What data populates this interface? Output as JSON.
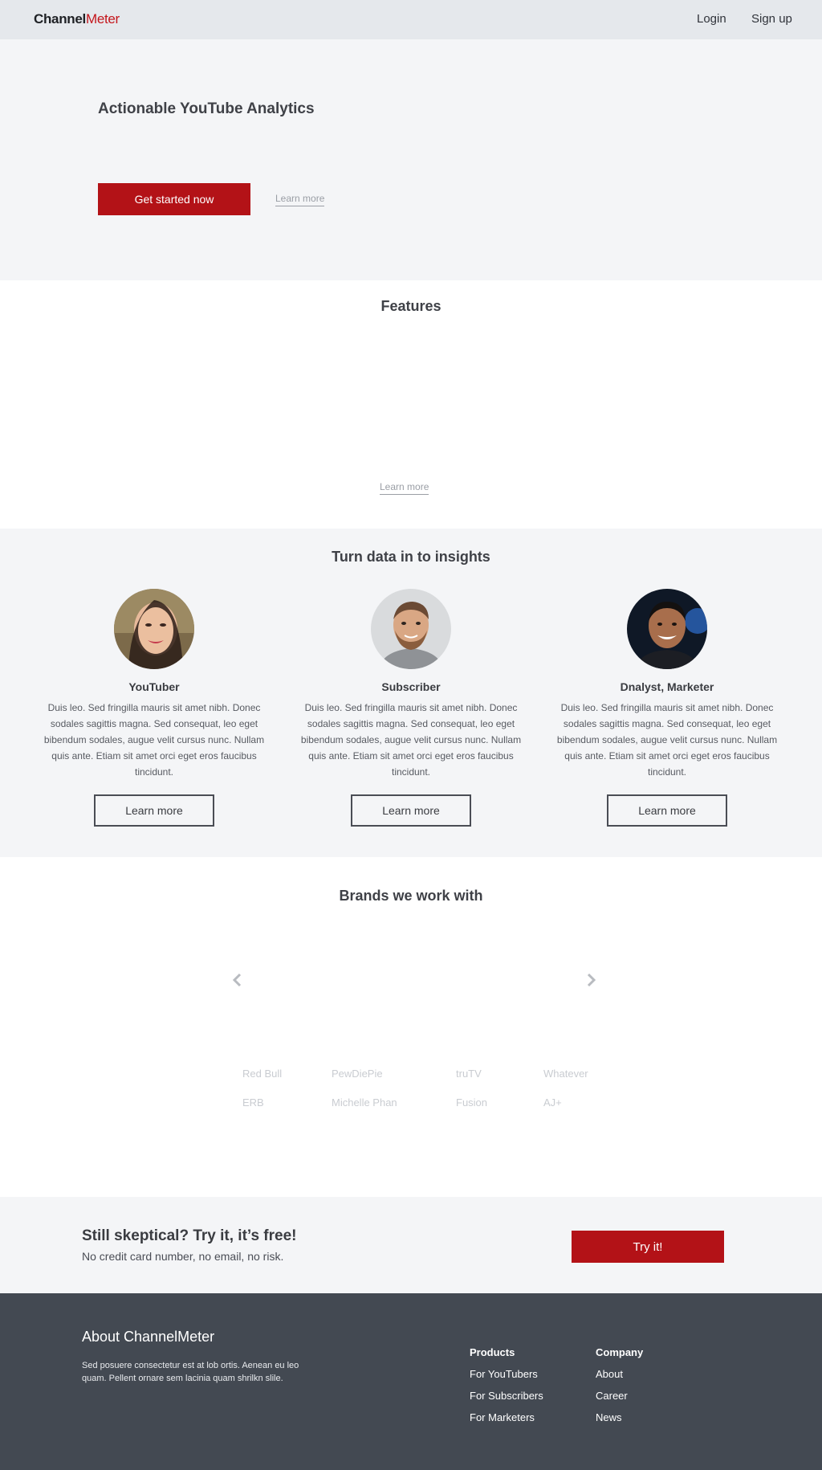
{
  "nav": {
    "logo_part1": "Channel",
    "logo_part2": "Meter",
    "login": "Login",
    "signup": "Sign up"
  },
  "hero": {
    "title": "Actionable YouTube Analytics",
    "cta_label": "Get started now",
    "learn_more": "Learn more"
  },
  "features": {
    "title": "Features",
    "learn_more": "Learn more"
  },
  "insights": {
    "title": "Turn data in to insights",
    "personas": [
      {
        "name": "YouTuber",
        "text": "Duis leo. Sed fringilla mauris sit amet nibh. Donec sodales sagittis magna. Sed consequat, leo eget bibendum sodales, augue velit cursus nunc. Nullam quis ante. Etiam sit amet orci eget eros faucibus tincidunt.",
        "button": "Learn more"
      },
      {
        "name": "Subscriber",
        "text": "Duis leo. Sed fringilla mauris sit amet nibh. Donec sodales sagittis magna. Sed consequat, leo eget bibendum sodales, augue velit cursus nunc. Nullam quis ante. Etiam sit amet orci eget eros faucibus tincidunt.",
        "button": "Learn more"
      },
      {
        "name": "Dnalyst, Marketer",
        "text": "Duis leo. Sed fringilla mauris sit amet nibh. Donec sodales sagittis magna. Sed consequat, leo eget bibendum sodales, augue velit cursus nunc. Nullam quis ante. Etiam sit amet orci eget eros faucibus tincidunt.",
        "button": "Learn more"
      }
    ]
  },
  "brands": {
    "title": "Brands we work with",
    "names": [
      "Red Bull",
      "PewDiePie",
      "truTV",
      "Whatever",
      "ERB",
      "Michelle Phan",
      "Fusion",
      "AJ+"
    ]
  },
  "cta": {
    "title": "Still skeptical? Try it, it’s free!",
    "subtitle": "No credit card number, no email, no risk.",
    "button": "Try it!"
  },
  "footer": {
    "title": "About ChannelMeter",
    "text": "Sed posuere consectetur est at lob ortis. Aenean eu leo quam. Pellent ornare sem lacinia quam shrilkn slile.",
    "products": {
      "title": "Products",
      "links": [
        "For YouTubers",
        "For Subscribers",
        "For Marketers"
      ]
    },
    "company": {
      "title": "Company",
      "links": [
        "About",
        "Career",
        "News"
      ]
    }
  },
  "colors": {
    "brand_red": "#b31217",
    "nav_bg": "#e5e8ec",
    "section_gray": "#f4f5f7",
    "footer_bg": "#434952"
  }
}
